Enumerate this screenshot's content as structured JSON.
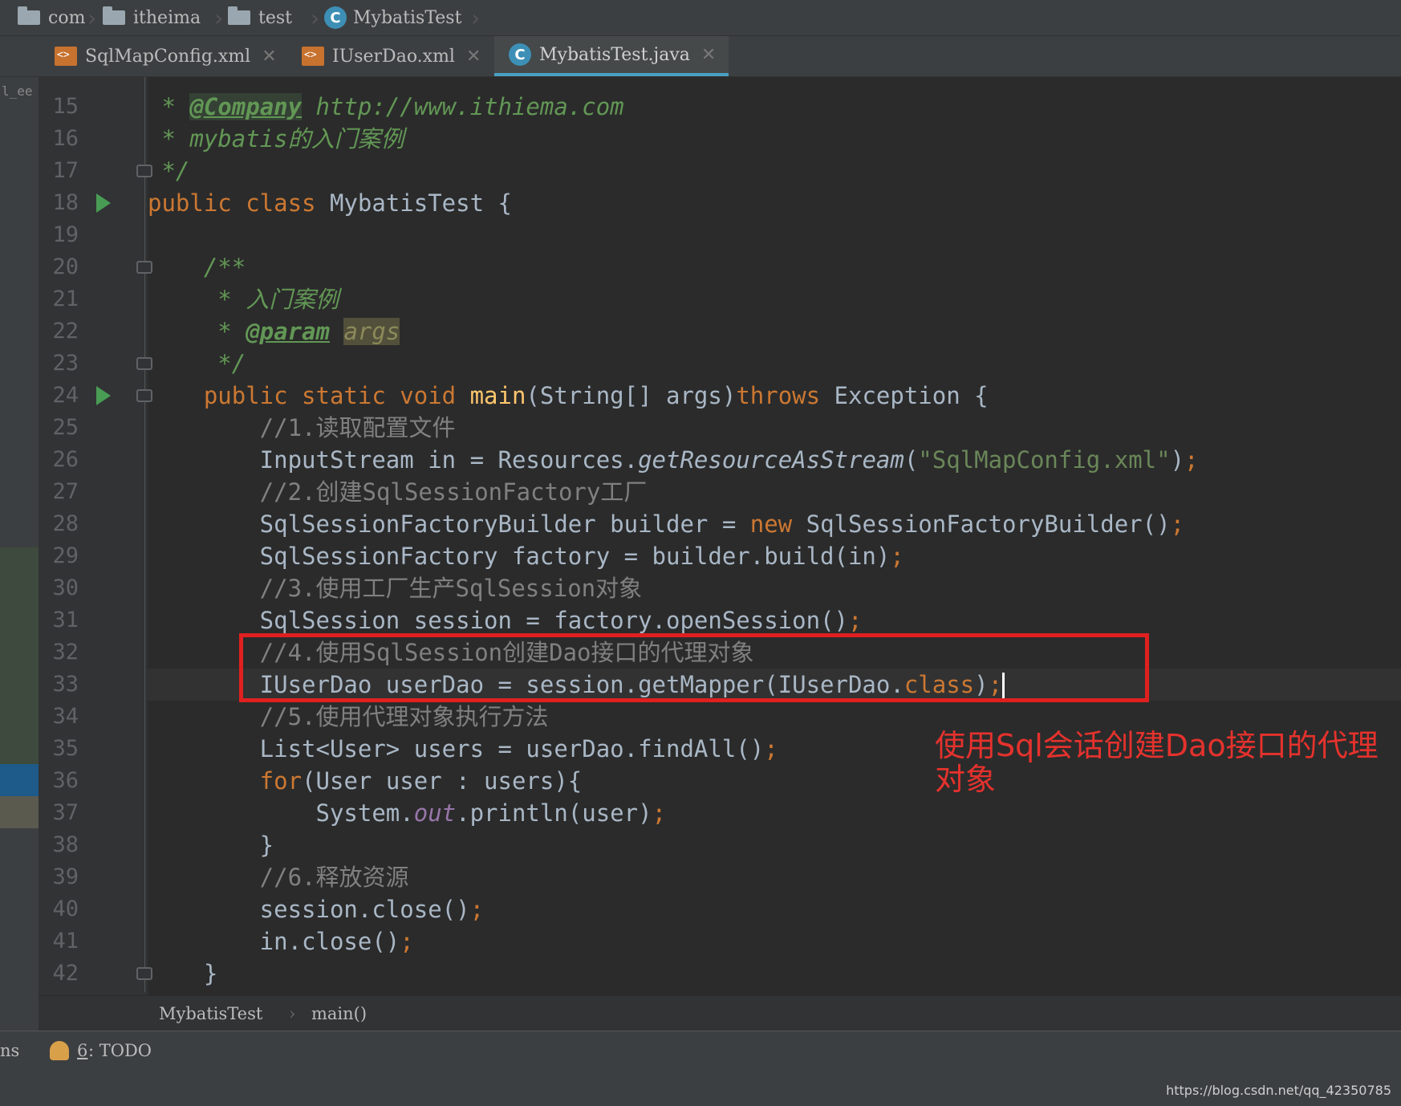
{
  "breadcrumb": [
    "com",
    "itheima",
    "test",
    "MybatisTest"
  ],
  "tabs": [
    {
      "label": "SqlMapConfig.xml",
      "active": false,
      "icon": "xml-file-icon"
    },
    {
      "label": "IUserDao.xml",
      "active": false,
      "icon": "xml-file-icon"
    },
    {
      "label": "MybatisTest.java",
      "active": true,
      "icon": "java-class-icon"
    }
  ],
  "left_strip_label": "l_ee",
  "line_numbers": [
    "15",
    "16",
    "17",
    "18",
    "19",
    "20",
    "21",
    "22",
    "23",
    "24",
    "25",
    "26",
    "27",
    "28",
    "29",
    "30",
    "31",
    "32",
    "33",
    "34",
    "35",
    "36",
    "37",
    "38",
    "39",
    "40",
    "41",
    "42"
  ],
  "code": {
    "l15_star": " * ",
    "l15_tag": "@Company",
    "l15_url": " http://www.ithiema.com",
    "l16": " * mybatis的入门案例",
    "l17": " */",
    "l18_kw": "public class ",
    "l18_rest": "MybatisTest {",
    "l20": "    /**",
    "l21": "     * 入门案例",
    "l22_star": "     * ",
    "l22_tag": "@param",
    "l22_arg": "args",
    "l23": "     */",
    "l24_kw": "    public static void ",
    "l24_fn": "main",
    "l24_a": "(String[] args)",
    "l24_kw2": "throws",
    "l24_b": " Exception {",
    "l25": "        //1.读取配置文件",
    "l26_a": "        InputStream in = Resources.",
    "l26_st": "getResourceAsStream",
    "l26_b": "(",
    "l26_str": "\"SqlMapConfig.xml\"",
    "l26_c": ")",
    "l26_semi": ";",
    "l27": "        //2.创建SqlSessionFactory工厂",
    "l28_a": "        SqlSessionFactoryBuilder builder = ",
    "l28_kw": "new",
    "l28_b": " SqlSessionFactoryBuilder()",
    "l28_semi": ";",
    "l29_a": "        SqlSessionFactory factory = builder.build(in)",
    "l29_semi": ";",
    "l30": "        //3.使用工厂生产SqlSession对象",
    "l31_a": "        SqlSession session = factory.openSession()",
    "l31_semi": ";",
    "l32": "        //4.使用SqlSession创建Dao接口的代理对象",
    "l33_a": "        IUserDao userDao = session.getMapper(IUserDao.",
    "l33_kw": "class",
    "l33_b": ")",
    "l33_semi": ";",
    "l34": "        //5.使用代理对象执行方法",
    "l35_a": "        List<User> users = userDao.findAll()",
    "l35_semi": ";",
    "l36_kw": "        for",
    "l36_b": "(User user : users){",
    "l37_a": "            System.",
    "l37_fld": "out",
    "l37_b": ".println(user)",
    "l37_semi": ";",
    "l38": "        }",
    "l39": "        //6.释放资源",
    "l40_a": "        session.close()",
    "l40_semi": ";",
    "l41_a": "        in.close()",
    "l41_semi": ";",
    "l42": "    }"
  },
  "annotation": "使用Sql会话创建Dao接口的代理对象",
  "bottom_breadcrumb": {
    "class": "MybatisTest",
    "method": "main()"
  },
  "status": {
    "left": "ns",
    "todo_number": "6",
    "todo_label": ": TODO"
  },
  "watermark": "https://blog.csdn.net/qq_42350785",
  "colors": {
    "keyword": "#cc7832",
    "comment": "#808080",
    "doc": "#629755",
    "string": "#6a8759",
    "method": "#ffc66d",
    "annotation_red": "#e02020"
  }
}
